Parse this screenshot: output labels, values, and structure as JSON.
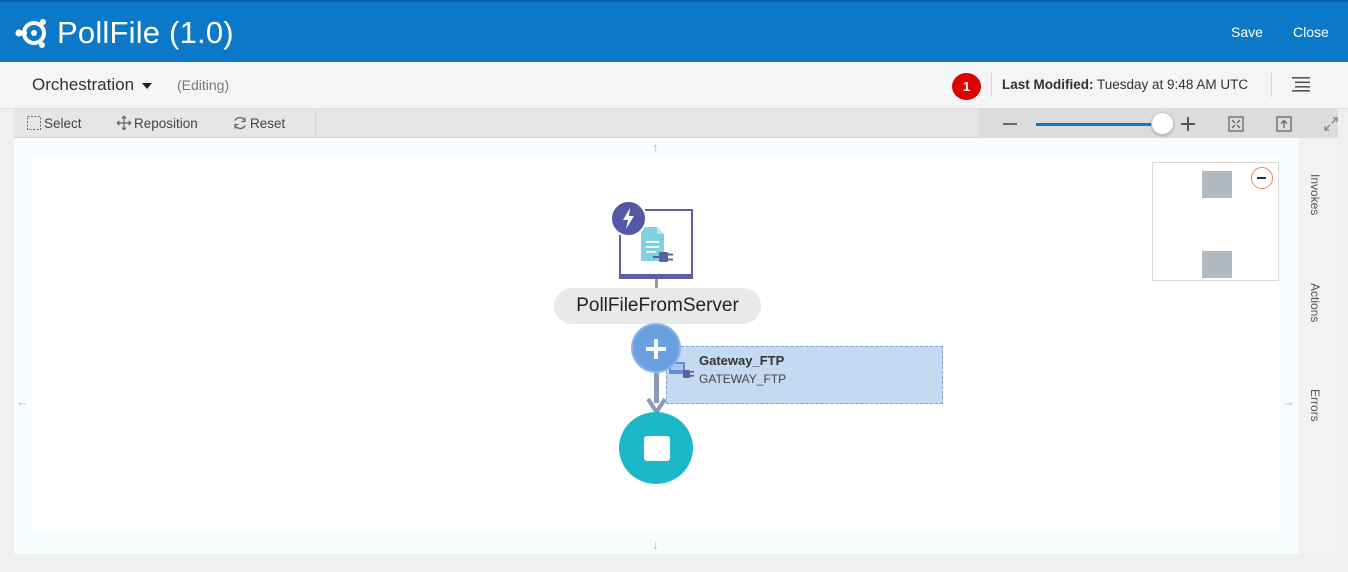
{
  "header": {
    "title": "PollFile (1.0)",
    "logo_icon": "integration-icon",
    "save_label": "Save",
    "close_label": "Close",
    "background": "#0b79c8"
  },
  "subheader": {
    "view_label": "Orchestration",
    "mode_label": "(Editing)",
    "error_count": "1",
    "last_modified_label": "Last Modified:",
    "last_modified_value": "Tuesday at 9:48 AM UTC",
    "menu_icon": "hamburger-menu-icon"
  },
  "toolbar": {
    "select_label": "Select",
    "reposition_label": "Reposition",
    "reset_label": "Reset",
    "zoom_level": 1.0,
    "zoom_out_icon": "zoom-out-icon",
    "zoom_in_icon": "zoom-in-icon",
    "fit_icon": "fit-to-screen-icon",
    "actual_size_icon": "actual-size-icon",
    "fullscreen_icon": "fullscreen-icon"
  },
  "canvas": {
    "pan_up": "↑",
    "pan_down": "↓",
    "pan_left": "←",
    "pan_right": "→",
    "trigger_node": {
      "label": "PollFileFromServer",
      "badge_icon": "bolt-icon",
      "type_icon": "file-adapter-icon",
      "border_color": "#5a5fa8"
    },
    "connection_popup": {
      "title": "Gateway_FTP",
      "subtitle": "GATEWAY_FTP"
    },
    "end_node_color": "#1cb7c8"
  },
  "side_panel": {
    "tabs": [
      "Invokes",
      "Actions",
      "Errors"
    ]
  },
  "error_badge_color": "#e00000",
  "accent": "#0b79c8"
}
